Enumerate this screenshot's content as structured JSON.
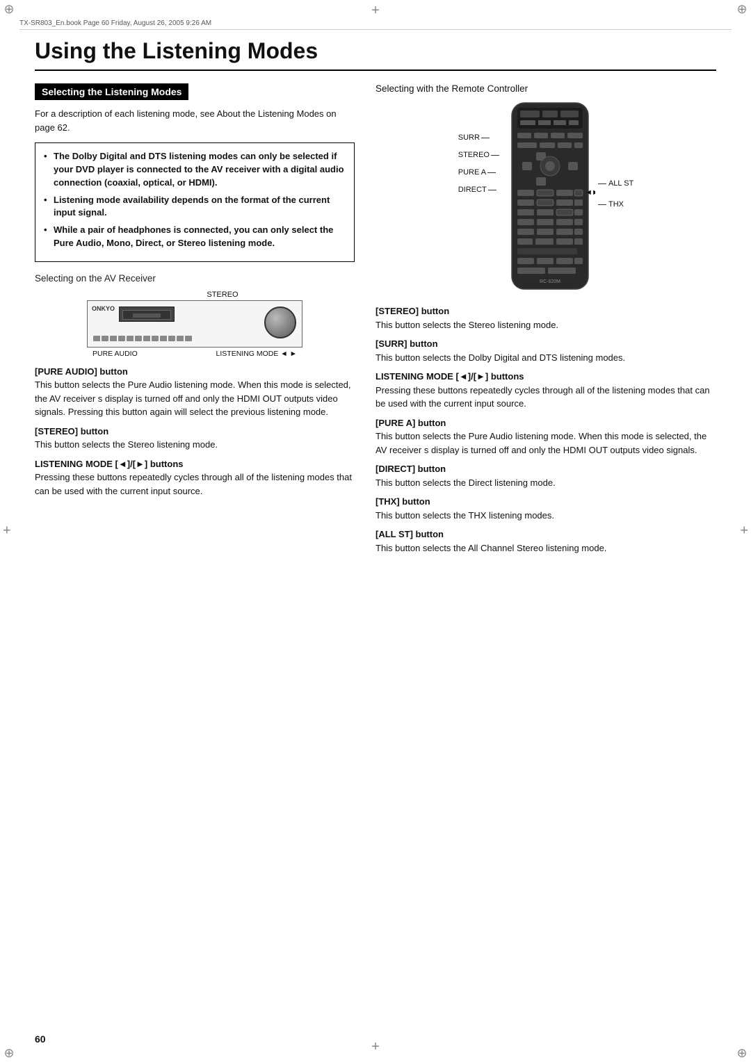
{
  "page": {
    "header_text": "TX-SR803_En.book  Page 60  Friday, August 26, 2005  9:26 AM",
    "page_number": "60",
    "title": "Using the Listening Modes",
    "section_heading": "Selecting the Listening Modes",
    "intro_text": "For a description of each listening mode, see  About the Listening Modes  on page 62.",
    "bullets": [
      "The Dolby Digital and DTS listening modes can only be selected if your DVD player is connected to the AV receiver with a digital audio connection (coaxial, optical, or HDMI).",
      "Listening mode availability depends on the format of the current input signal.",
      "While a pair of headphones is connected, you can only select the Pure Audio, Mono, Direct, or Stereo listening mode."
    ],
    "av_receiver": {
      "title": "Selecting on the AV Receiver",
      "label_stereo": "STEREO",
      "label_pure_audio": "PURE AUDIO",
      "label_listening_mode": "LISTENING MODE ◄ ►"
    },
    "av_buttons": [
      {
        "title": "[PURE AUDIO] button",
        "text": "This button selects the Pure Audio listening mode. When this mode is selected, the AV receiver s display is turned off and only the HDMI OUT outputs video signals. Pressing this button again will select the previous listening mode."
      },
      {
        "title": "[STEREO] button",
        "text": "This button selects the Stereo listening mode."
      },
      {
        "title": "LISTENING MODE [◄]/[►] buttons",
        "text": "Pressing these buttons repeatedly cycles through all of the listening modes that can be used with the current input source."
      }
    ],
    "remote_controller": {
      "title": "Selecting with the Remote Controller",
      "labels_left": [
        "SURR",
        "STEREO",
        "PURE A",
        "DIRECT"
      ],
      "labels_right": [
        "ALL ST",
        "THX"
      ]
    },
    "remote_buttons": [
      {
        "title": "[STEREO] button",
        "text": "This button selects the Stereo listening mode."
      },
      {
        "title": "[SURR] button",
        "text": "This button selects the Dolby Digital and DTS listening modes."
      },
      {
        "title": "LISTENING MODE [◄]/[►] buttons",
        "text": "Pressing these buttons repeatedly cycles through all of the listening modes that can be used with the current input source."
      },
      {
        "title": "[PURE A] button",
        "text": "This button selects the Pure Audio listening mode. When this mode is selected, the AV receiver s display is turned off and only the HDMI OUT outputs video signals."
      },
      {
        "title": "[DIRECT] button",
        "text": "This button selects the Direct listening mode."
      },
      {
        "title": "[THX] button",
        "text": "This button selects the THX listening modes."
      },
      {
        "title": "[ALL ST] button",
        "text": "This button selects the All Channel Stereo listening mode."
      }
    ]
  }
}
